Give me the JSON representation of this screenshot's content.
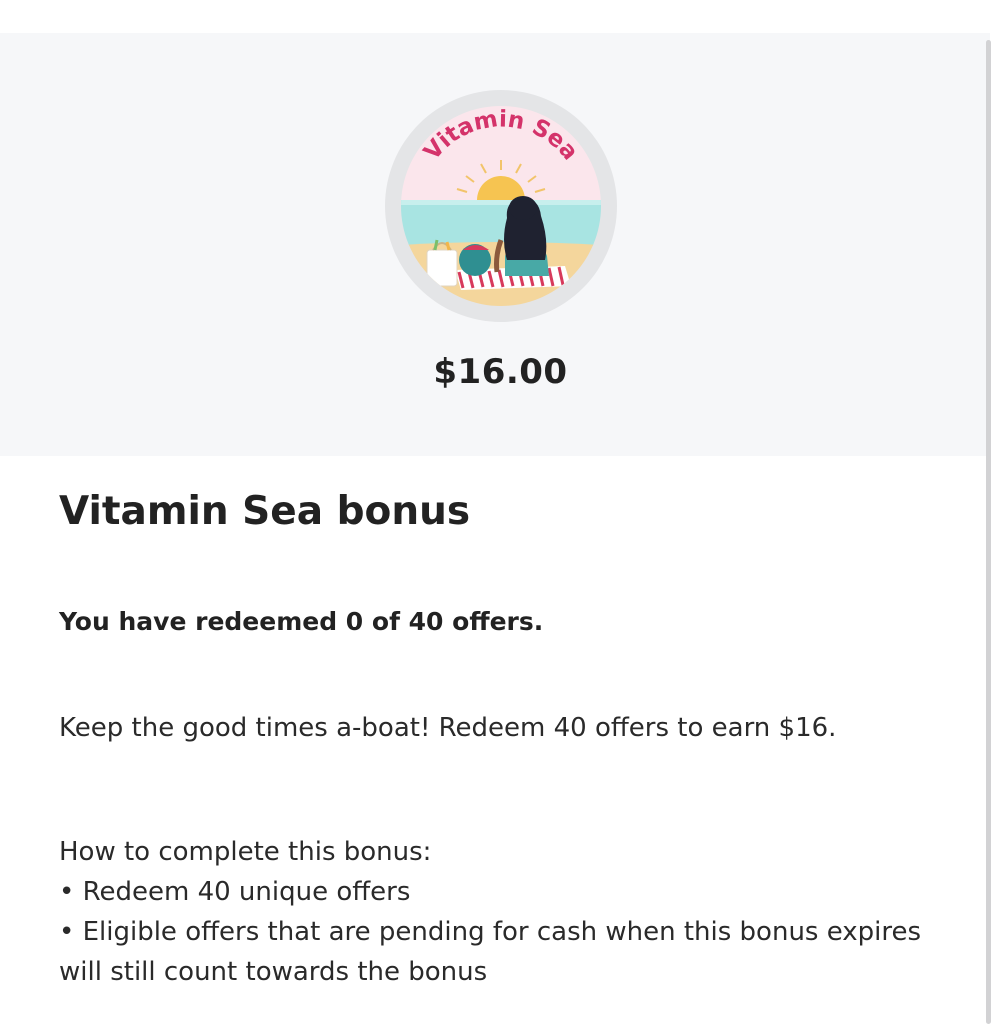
{
  "hero": {
    "badge_text": "Vitamin Sea",
    "amount": "$16.00"
  },
  "bonus": {
    "title": "Vitamin Sea bonus",
    "progress_text": "You have redeemed 0 of 40 offers.",
    "description": "Keep the good times a-boat! Redeem 40 offers to earn $16.",
    "howto_heading": "How to complete this bonus:",
    "howto_items": [
      "• Redeem 40 unique offers",
      "• Eligible offers that are pending for cash when this bonus expires will still count towards the bonus"
    ]
  },
  "colors": {
    "hero_background": "#f6f7f9",
    "badge_text": "#d4336a",
    "sky": "#fbe6ec",
    "sea": "#a8e4e2",
    "sand": "#f4d69c",
    "sun": "#f6c451",
    "text": "#222222"
  }
}
